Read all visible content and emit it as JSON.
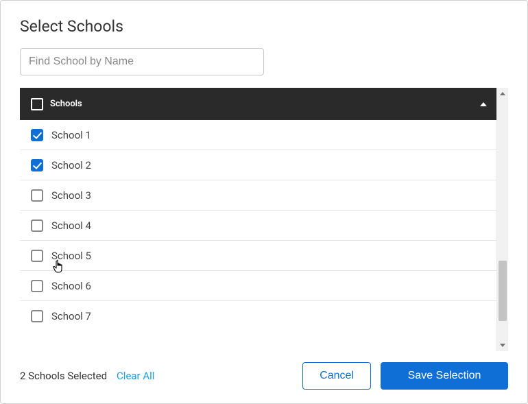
{
  "title": "Select Schools",
  "search": {
    "placeholder": "Find School by Name",
    "value": ""
  },
  "header": {
    "label": "Schools",
    "allChecked": false
  },
  "rows": [
    {
      "label": "School 1",
      "checked": true
    },
    {
      "label": "School 2",
      "checked": true
    },
    {
      "label": "School 3",
      "checked": false
    },
    {
      "label": "School 4",
      "checked": false
    },
    {
      "label": "School 5",
      "checked": false
    },
    {
      "label": "School 6",
      "checked": false
    },
    {
      "label": "School 7",
      "checked": false
    }
  ],
  "footer": {
    "status": "2 Schools Selected",
    "clearAll": "Clear All",
    "cancel": "Cancel",
    "save": "Save Selection"
  },
  "colors": {
    "accent": "#0f6fd6",
    "link": "#169fe6",
    "headerBg": "#2a2a2a"
  }
}
